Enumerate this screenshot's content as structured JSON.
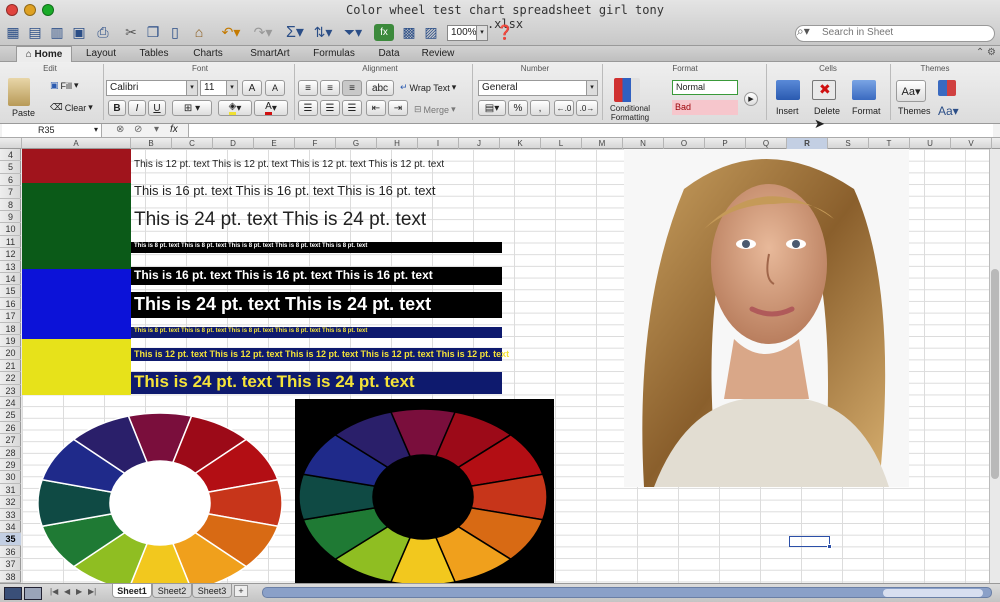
{
  "window": {
    "title": "Color wheel test chart spreadsheet girl tony .xlsx"
  },
  "toolbar": {
    "zoom": "100%"
  },
  "search": {
    "placeholder": "Search in Sheet"
  },
  "ribbon": {
    "tabs": [
      "Home",
      "Layout",
      "Tables",
      "Charts",
      "SmartArt",
      "Formulas",
      "Data",
      "Review"
    ],
    "active_tab": "Home",
    "groups": [
      "Edit",
      "Font",
      "Alignment",
      "Number",
      "Format",
      "Cells",
      "Themes"
    ],
    "paste_label": "Paste",
    "fill_label": "Fill",
    "clear_label": "Clear",
    "font_name": "Calibri",
    "font_size": "11",
    "wrap_text_label": "Wrap Text",
    "merge_label": "Merge",
    "align_abc": "abc",
    "number_format": "General",
    "cond_format_label": "Conditional Formatting",
    "style_normal": "Normal",
    "style_bad": "Bad",
    "insert_label": "Insert",
    "delete_label": "Delete",
    "format_label": "Format",
    "themes_label": "Themes",
    "bold": "B",
    "italic": "I",
    "underline": "U",
    "font_grow": "A",
    "font_shrink": "A",
    "percent": "%",
    "comma": ","
  },
  "formula_bar": {
    "cell_ref": "R35",
    "fx": "fx"
  },
  "columns": [
    "A",
    "B",
    "C",
    "D",
    "E",
    "F",
    "G",
    "H",
    "I",
    "J",
    "K",
    "L",
    "M",
    "N",
    "O",
    "P",
    "Q",
    "R",
    "S",
    "T",
    "U",
    "V"
  ],
  "selected_column": "R",
  "rows": [
    "4",
    "5",
    "6",
    "7",
    "8",
    "9",
    "10",
    "11",
    "12",
    "13",
    "14",
    "15",
    "16",
    "17",
    "18",
    "19",
    "20",
    "21",
    "22",
    "23",
    "24",
    "25",
    "26",
    "27",
    "28",
    "29",
    "30",
    "31",
    "32",
    "33",
    "34",
    "35",
    "36",
    "37",
    "38"
  ],
  "selected_row": "35",
  "cells": {
    "text_12_row": "This is 12 pt. text   This is 12 pt. text   This is 12 pt. text   This is 12 pt. text",
    "text_16_row": "This is 16 pt. text   This is 16 pt. text   This is 16 pt. text",
    "text_24_row": "This is 24 pt. text   This is 24 pt. text",
    "text_8_row": "This is 8 pt. text   This is 8 pt. text   This is 8 pt. text   This is 8 pt. text   This is 8 pt. text",
    "text_16_white": "This is 16 pt. text   This is 16 pt. text   This is 16 pt. text",
    "text_24_white": "This is 24 pt. text   This is 24 pt. text",
    "text_8_blue": "This is 8 pt. text   This is 8 pt. text   This is 8 pt. text   This is 8 pt. text   This is 8 pt. text",
    "text_12_yellow": "This is 12 pt. text   This is 12 pt. text   This is 12 pt. text   This is 12 pt. text   This is 12 pt. text",
    "text_24_yellow": "This is 24 pt. text   This is 24 pt. text"
  },
  "colors": {
    "red": "#a0141c",
    "green": "#0b5a18",
    "blue": "#0c12d8",
    "yellow": "#e7e21a",
    "navy": "#0e1a6e",
    "black": "#000000",
    "text_yellow": "#f4e33a"
  },
  "color_wheel_segments": [
    "#7a0e3c",
    "#9c0a18",
    "#b30e14",
    "#c7351a",
    "#d86a14",
    "#f0a01c",
    "#f2c81e",
    "#8fbe22",
    "#1f7a34",
    "#0f4a44",
    "#1f2a8a",
    "#2a1f6a"
  ],
  "sheet_tabs": [
    "Sheet1",
    "Sheet2",
    "Sheet3"
  ],
  "active_sheet": "Sheet1",
  "icons": [
    "search-icon",
    "cursor-icon",
    "sum-icon",
    "undo-icon",
    "redo-icon",
    "new-icon",
    "open-icon",
    "save-icon",
    "print-icon",
    "cut-icon",
    "copy-icon",
    "paste-icon",
    "format-painter-icon",
    "sort-icon",
    "filter-icon",
    "help-icon"
  ]
}
